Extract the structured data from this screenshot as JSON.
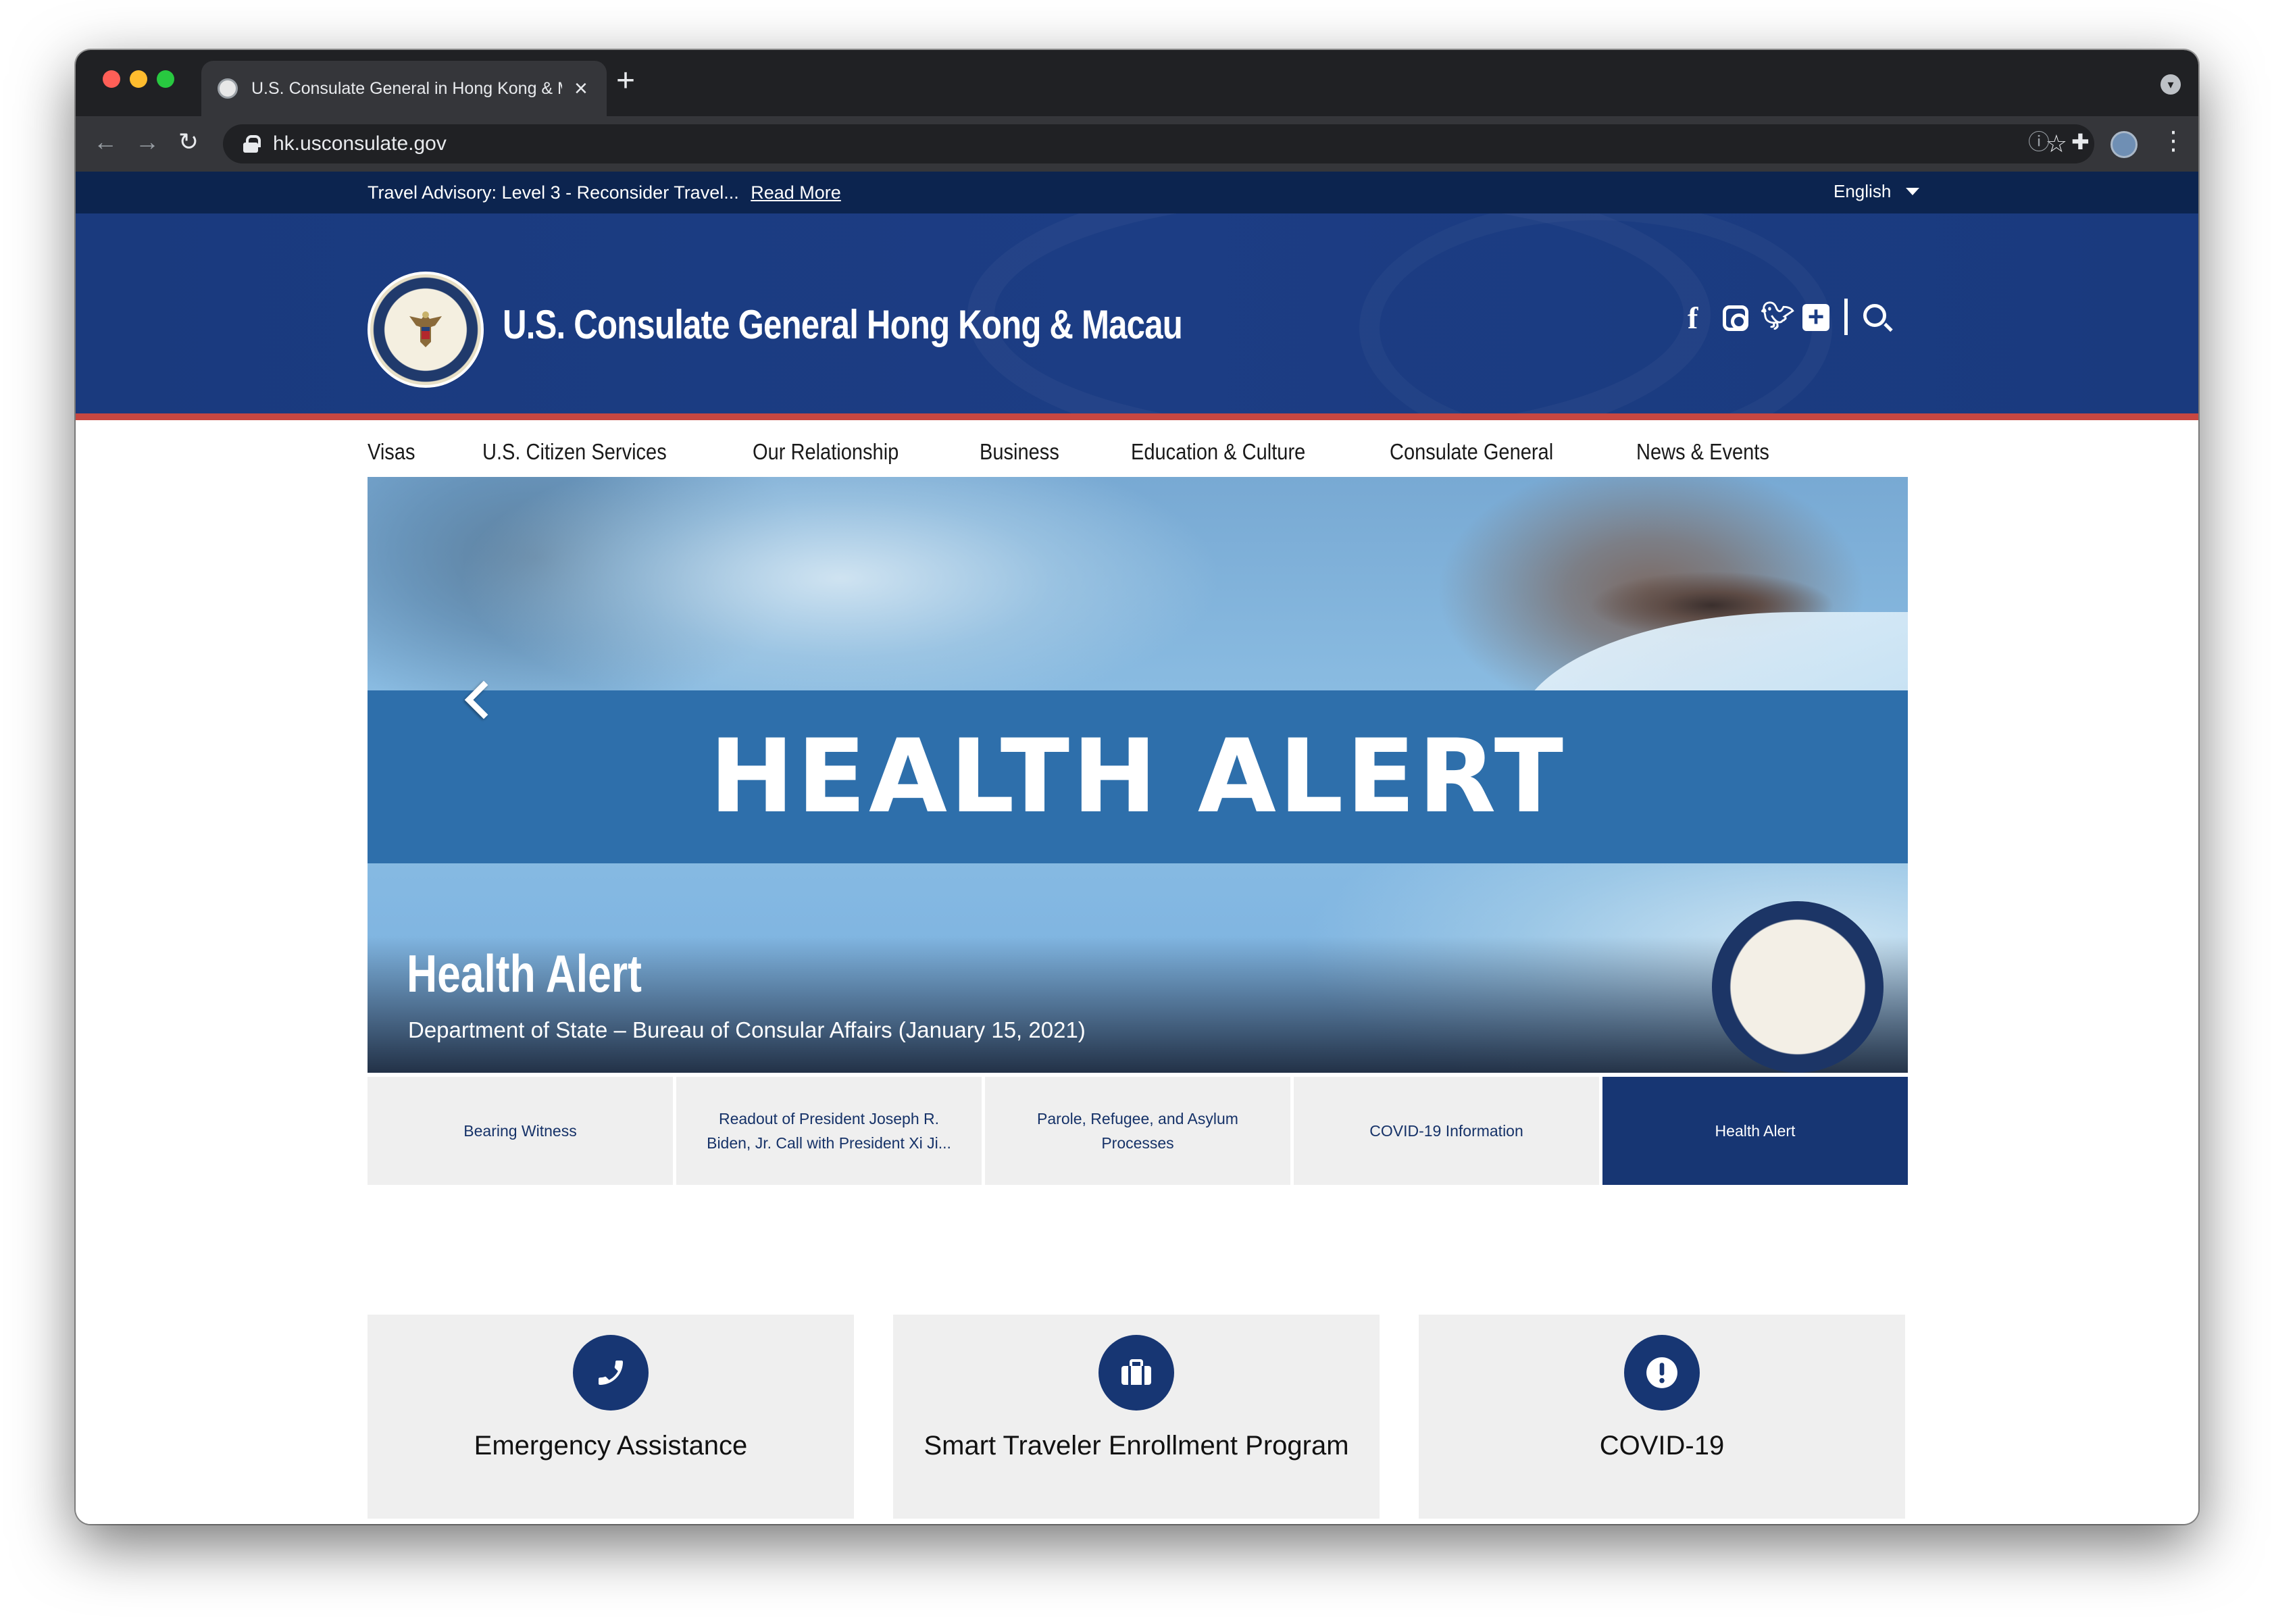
{
  "browser": {
    "tab_title": "U.S. Consulate General in Hong Kong & Macau",
    "url": "hk.usconsulate.gov",
    "new_tab_label": "+",
    "tab_close_label": "×"
  },
  "advisory": {
    "text": "Travel Advisory: Level 3 - Reconsider Travel...",
    "link": "Read More"
  },
  "language": {
    "selected": "English"
  },
  "header": {
    "title": "U.S. Consulate General Hong Kong & Macau"
  },
  "nav": {
    "items": [
      "Visas",
      "U.S. Citizen Services",
      "Our Relationship",
      "Business",
      "Education & Culture",
      "Consulate General",
      "News & Events"
    ]
  },
  "hero": {
    "banner_text": "HEALTH ALERT",
    "title": "Health Alert",
    "subtitle": "Department of State – Bureau of Consular Affairs (January 15, 2021)"
  },
  "slides": [
    {
      "label": "Bearing Witness",
      "active": false
    },
    {
      "label": "Readout of President Joseph R. Biden, Jr. Call with President Xi Ji...",
      "active": false
    },
    {
      "label": "Parole, Refugee, and Asylum Processes",
      "active": false
    },
    {
      "label": "COVID-19 Information",
      "active": false
    },
    {
      "label": "Health Alert",
      "active": true
    }
  ],
  "cards": [
    {
      "label": "Emergency Assistance",
      "icon": "phone-icon"
    },
    {
      "label": "Smart Traveler Enrollment Program",
      "icon": "briefcase-icon"
    },
    {
      "label": "COVID-19",
      "icon": "exclamation-icon"
    }
  ],
  "colors": {
    "brand_navy": "#173673",
    "header_blue": "#1c3d84",
    "advisory_bar": "#0c244f",
    "accent_red": "#c74741",
    "hero_band": "#2e6fab"
  }
}
